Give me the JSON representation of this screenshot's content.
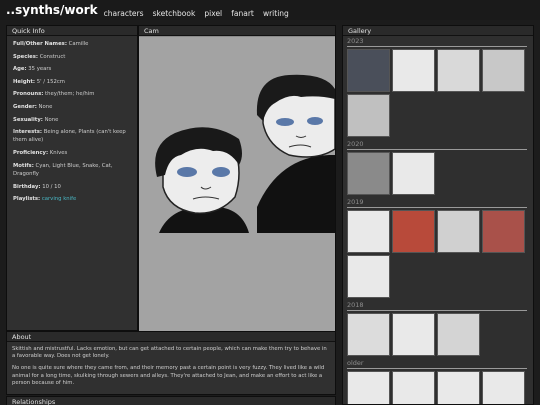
{
  "site": {
    "title": "..synths/work",
    "nav": [
      "characters",
      "sketchbook",
      "pixel",
      "fanart",
      "writing"
    ]
  },
  "quick_info": {
    "heading": "Quick Info",
    "fields": [
      {
        "label": "Full/Other Names:",
        "value": "Camille"
      },
      {
        "label": "Species:",
        "value": "Construct"
      },
      {
        "label": "Age:",
        "value": "35 years"
      },
      {
        "label": "Height:",
        "value": "5' / 152cm"
      },
      {
        "label": "Pronouns:",
        "value": "they/them; he/him"
      },
      {
        "label": "Gender:",
        "value": "None"
      },
      {
        "label": "Sexuality:",
        "value": "None"
      },
      {
        "label": "Interests:",
        "value": "Being alone, Plants (can't keep them alive)"
      },
      {
        "label": "Proficiency:",
        "value": "Knives"
      },
      {
        "label": "Motifs:",
        "value": "Cyan, Light Blue, Snake, Cat, Dragonfly"
      },
      {
        "label": "Birthday:",
        "value": "10 / 10"
      },
      {
        "label": "Playlists:",
        "value": "carving knife"
      }
    ]
  },
  "cam": {
    "heading": "Cam"
  },
  "about": {
    "heading": "About",
    "paragraphs": [
      "Skittish and mistrustful. Lacks emotion, but can get attached to certain people, which can make them try to behave in a favorable way. Does not get lonely.",
      "No one is quite sure where they came from, and their memory past a certain point is very fuzzy. They lived like a wild animal for a long time, skulking through sewers and alleys. They're attached to Jean, and make an effort to act like a person because of him."
    ]
  },
  "relationships": {
    "heading": "Relationships"
  },
  "gallery": {
    "heading": "Gallery",
    "sections": [
      {
        "year": "2023",
        "count": 5
      },
      {
        "year": "2020",
        "count": 2
      },
      {
        "year": "2019",
        "count": 5
      },
      {
        "year": "2018",
        "count": 3
      },
      {
        "year": "older",
        "count": 4
      }
    ]
  },
  "colors": {
    "background": "#1c1c1c",
    "panel": "#303030",
    "link_accent": "#49b7c4",
    "cam_bg": "#a3a3a3"
  }
}
